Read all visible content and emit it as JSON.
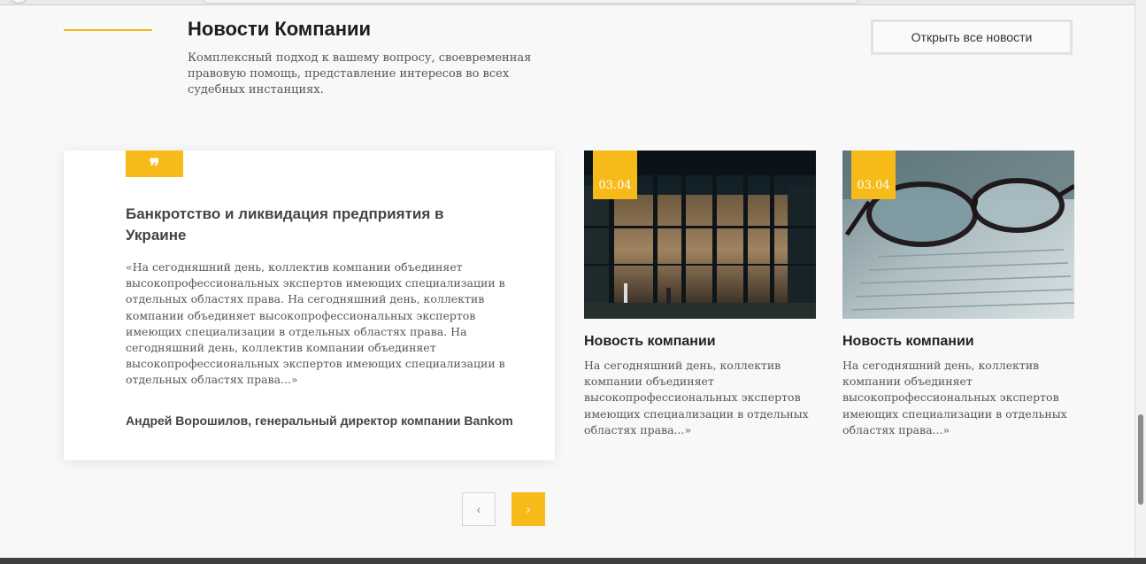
{
  "header": {
    "title": "Новости Компании",
    "subtitle": "Комплексный подход к вашему вопросу, своевременная правовую помощь, представление интересов во всех судебных инстанциях.",
    "all_news_button": "Открыть все новости"
  },
  "featured": {
    "quote_icon": "❞",
    "title": "Банкротство и ликвидация предприятия в Украине",
    "text": "«На сегодняшний день, коллектив компании объединяет высокопрофессиональных экспертов имеющих специализации в отдельных областях права. На сегодняшний день, коллектив компании объединяет высокопрофессиональных экспертов имеющих специализации в отдельных областях права. На сегодняшний день, коллектив компании объединяет высокопрофессиональных экспертов имеющих специализации в отдельных областях права...»",
    "author": "Андрей Ворошилов, генеральный директор компании Bankom"
  },
  "news": [
    {
      "date": "03.04",
      "title": "Новость компании",
      "text": "На сегодняшний день, коллектив компании объединяет высокопрофессиональных экспертов имеющих специализации в отдельных областях права...»",
      "image_icon": "building-photo"
    },
    {
      "date": "03.04",
      "title": "Новость компании",
      "text": "На сегодняшний день, коллектив компании объединяет высокопрофессиональных экспертов имеющих специализации в отдельных областях права...»",
      "image_icon": "glasses-photo"
    }
  ],
  "pagination": {
    "prev": "‹",
    "next": "›"
  },
  "colors": {
    "accent": "#f6bb18",
    "footer": "#3f3f3f"
  }
}
